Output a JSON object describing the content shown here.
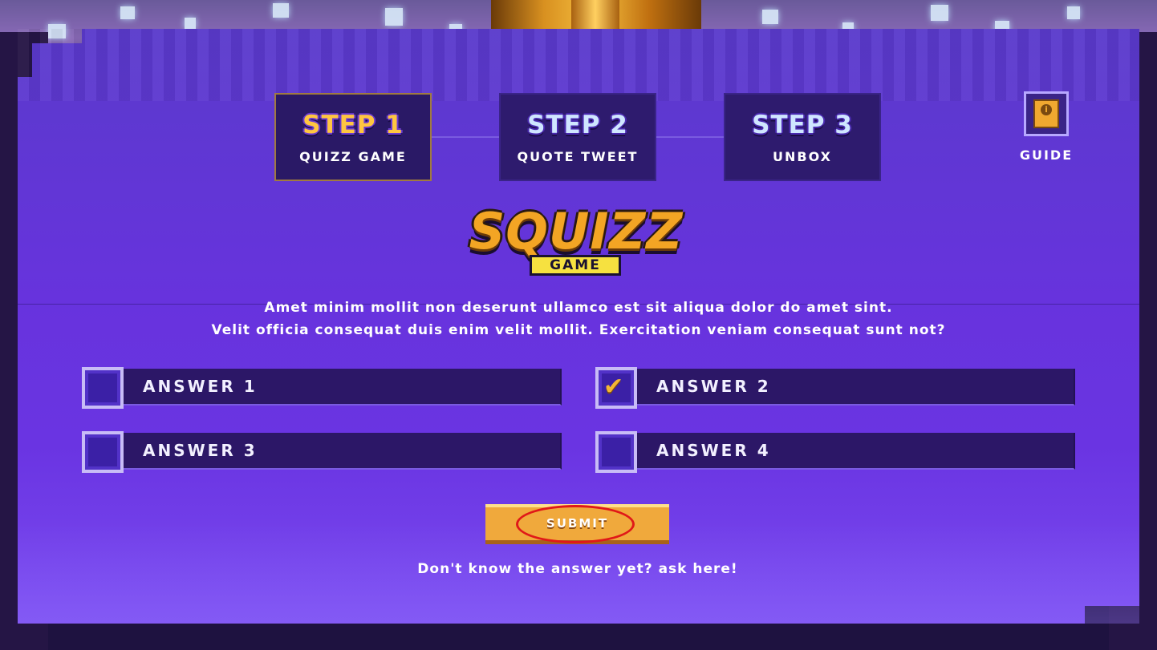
{
  "steps": [
    {
      "title": "STEP 1",
      "subtitle": "QUIZZ GAME",
      "active": true
    },
    {
      "title": "STEP 2",
      "subtitle": "QUOTE TWEET",
      "active": false
    },
    {
      "title": "STEP 3",
      "subtitle": "UNBOX",
      "active": false
    }
  ],
  "guide": {
    "label": "GUIDE",
    "icon": "info-book-icon"
  },
  "logo": {
    "main": "SQUIZZ",
    "sub": "GAME"
  },
  "question": {
    "line1": "Amet minim mollit non deserunt ullamco est sit aliqua dolor do amet sint.",
    "line2": "Velit officia consequat duis enim velit mollit.  Exercitation veniam consequat sunt not?"
  },
  "answers": [
    {
      "label": "ANSWER 1",
      "checked": false
    },
    {
      "label": "ANSWER 2",
      "checked": true
    },
    {
      "label": "ANSWER 3",
      "checked": false
    },
    {
      "label": "ANSWER 4",
      "checked": false
    }
  ],
  "submit_label": "SUBMIT",
  "ask_link": "Don't know the answer yet? ask here!",
  "colors": {
    "panel": "#6733dd",
    "step_bg": "#2e1b6e",
    "accent_gold": "#f0a93c",
    "highlight_ring": "#e01818"
  }
}
